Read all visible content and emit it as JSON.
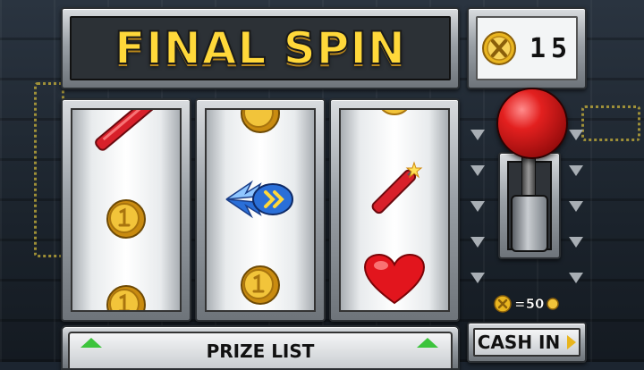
{
  "title": "FINAL SPIN",
  "tokens": {
    "count": "15",
    "icon": "x-token-icon"
  },
  "reels": [
    {
      "symbols": [
        "dynamite-icon",
        "coin-icon",
        "coin-icon"
      ]
    },
    {
      "symbols": [
        "coin-icon",
        "speed-boost-icon",
        "coin-icon"
      ]
    },
    {
      "symbols": [
        "coin-icon",
        "dynamite-icon",
        "heart-icon"
      ]
    }
  ],
  "lever": {
    "icon": "lever-knob-icon"
  },
  "spin_cost": {
    "text": "=50"
  },
  "prize_list": {
    "label": "PRIZE LIST"
  },
  "cash_in": {
    "label": "CASH IN"
  },
  "colors": {
    "title_yellow": "#ffd83a",
    "lever_red": "#e3201f",
    "arrow_green": "#3cc43c",
    "coin_gold": "#e9b520",
    "dynamite_red": "#d8202a",
    "boost_blue": "#2a6fd8"
  }
}
